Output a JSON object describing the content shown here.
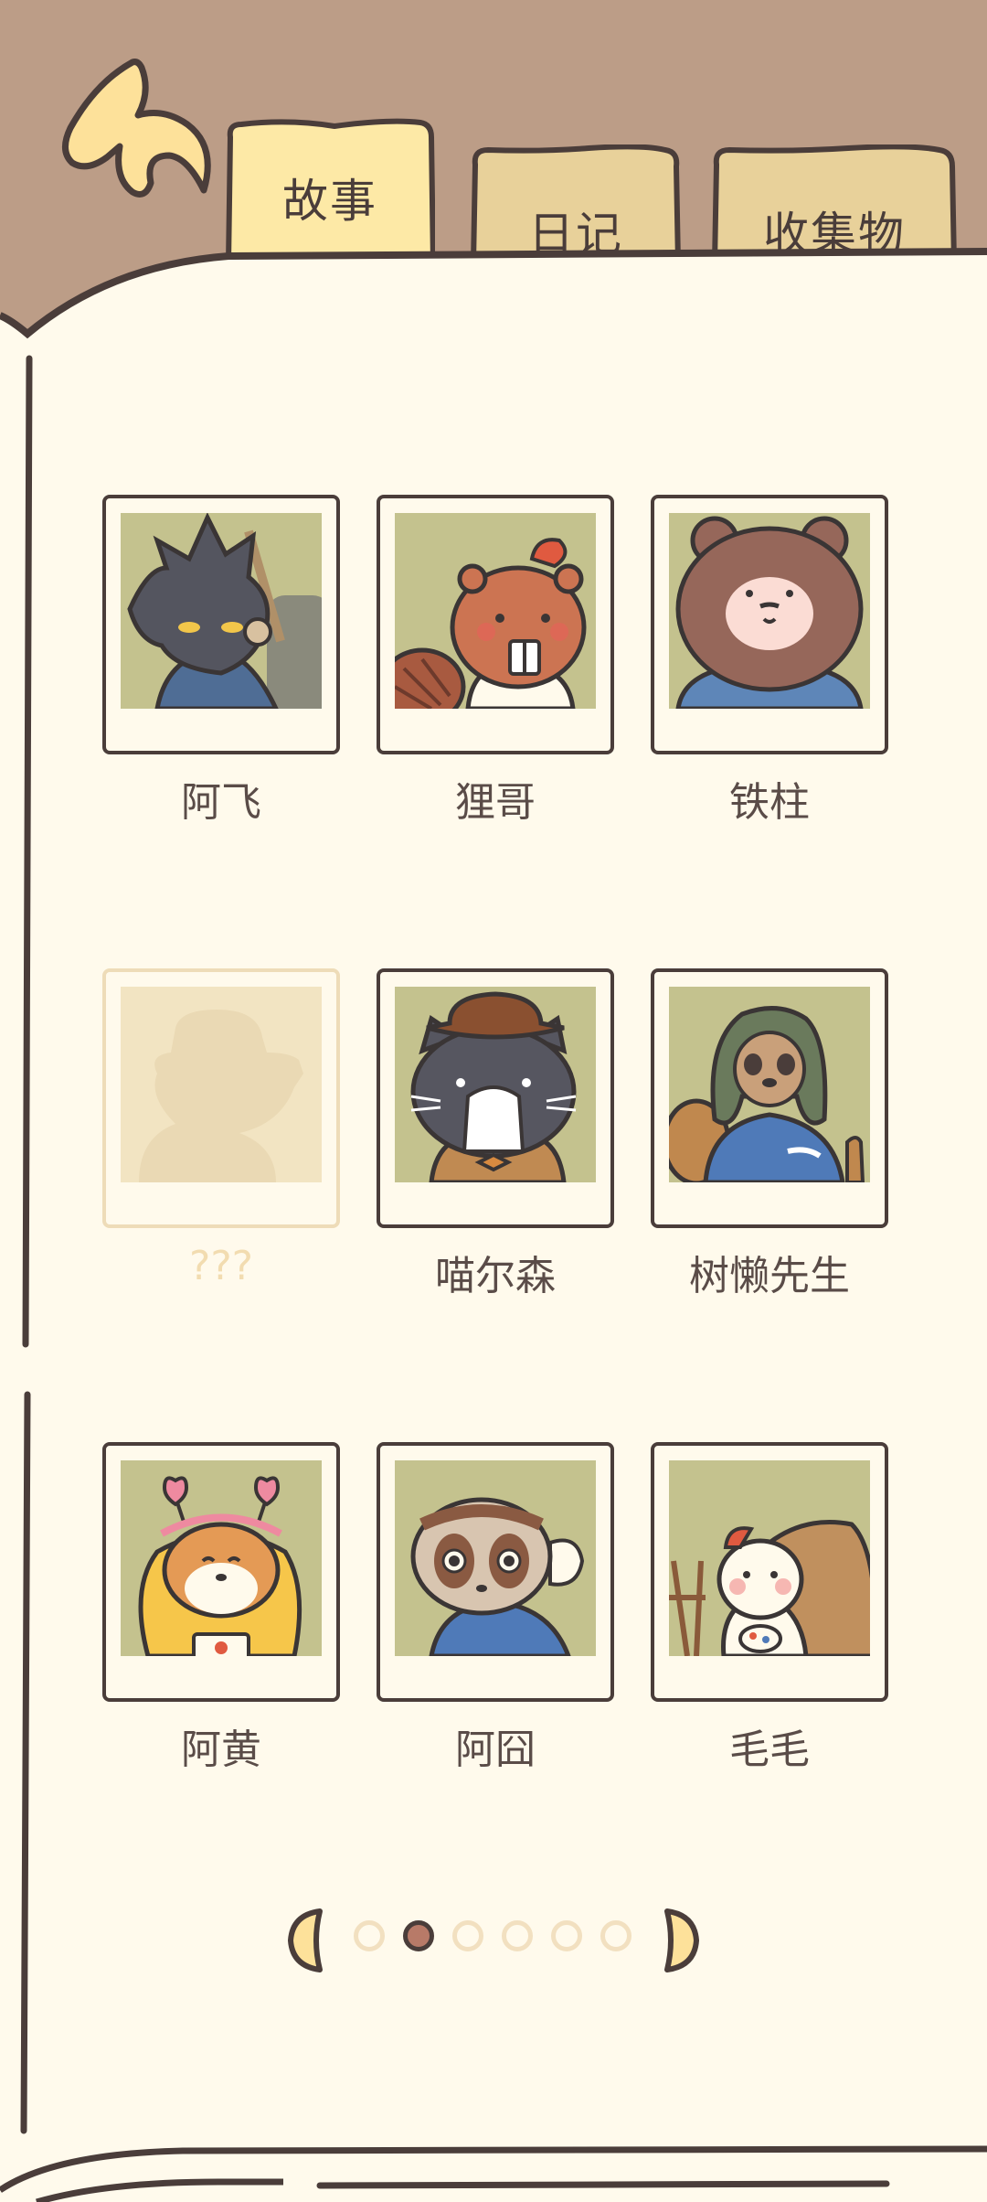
{
  "tabs": [
    {
      "label": "故事",
      "selected": true
    },
    {
      "label": "日记",
      "selected": false
    },
    {
      "label": "收集物",
      "selected": false
    }
  ],
  "characters": [
    {
      "name": "阿飞",
      "icon": "wolf-portrait",
      "locked": false
    },
    {
      "name": "狸哥",
      "icon": "beaver-portrait",
      "locked": false
    },
    {
      "name": "铁柱",
      "icon": "bear-portrait",
      "locked": false
    },
    {
      "name": "???",
      "icon": "locked-silhouette",
      "locked": true
    },
    {
      "name": "喵尔森",
      "icon": "cat-portrait",
      "locked": false
    },
    {
      "name": "树懒先生",
      "icon": "sloth-portrait",
      "locked": false
    },
    {
      "name": "阿黄",
      "icon": "shiba-portrait",
      "locked": false
    },
    {
      "name": "阿囧",
      "icon": "loris-portrait",
      "locked": false
    },
    {
      "name": "毛毛",
      "icon": "hamster-portrait",
      "locked": false
    }
  ],
  "pagination": {
    "total_pages": 6,
    "current_page": 2
  },
  "colors": {
    "background": "#bc9d87",
    "page": "#fffaec",
    "tab_active": "#fde9a6",
    "tab_inactive": "#e8d19a",
    "outline": "#4a3d3a",
    "photo_bg": "#c4c28e",
    "dot_active": "#b87a68"
  }
}
